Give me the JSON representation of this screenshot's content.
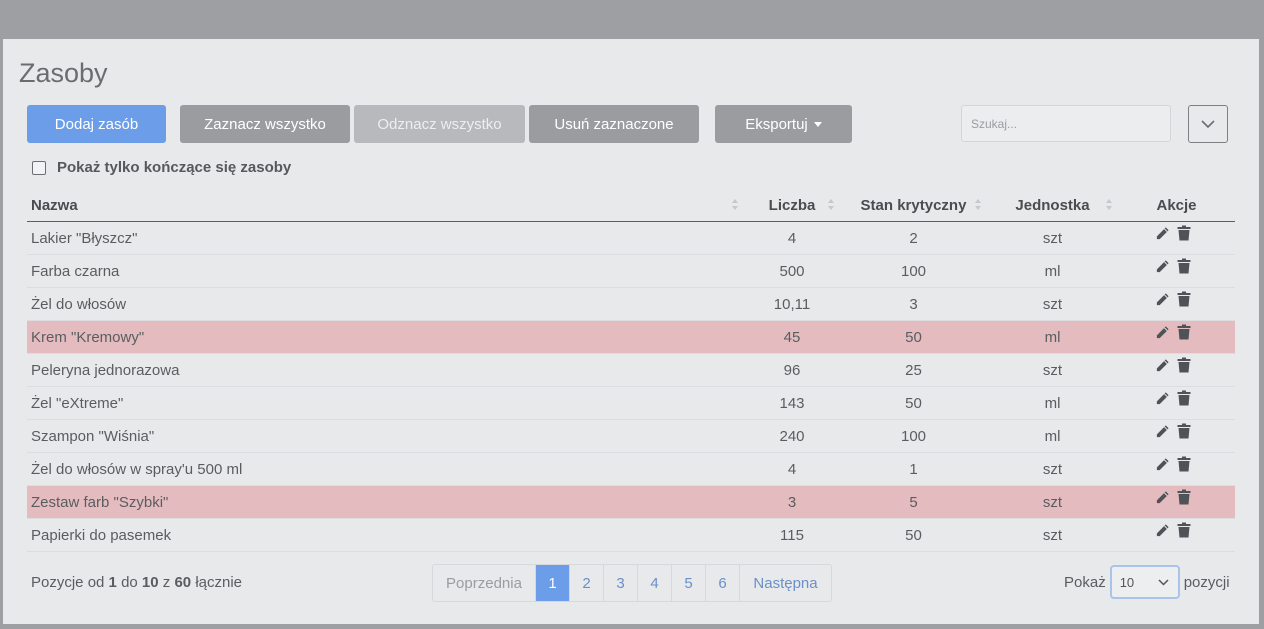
{
  "page": {
    "title": "Zasoby"
  },
  "toolbar": {
    "add_label": "Dodaj zasób",
    "select_all_label": "Zaznacz wszystko",
    "deselect_all_label": "Odznacz wszystko",
    "delete_selected_label": "Usuń zaznaczone",
    "export_label": "Eksportuj",
    "search_placeholder": "Szukaj..."
  },
  "filter": {
    "label": "Pokaż tylko kończące się zasoby",
    "checked": false
  },
  "table": {
    "columns": [
      "Nazwa",
      "Liczba",
      "Stan krytyczny",
      "Jednostka",
      "Akcje"
    ],
    "rows": [
      {
        "name": "Lakier \"Błyszcz\"",
        "count": "4",
        "critical": "2",
        "unit": "szt",
        "warn": false
      },
      {
        "name": "Farba czarna",
        "count": "500",
        "critical": "100",
        "unit": "ml",
        "warn": false
      },
      {
        "name": "Żel do włosów",
        "count": "10,11",
        "critical": "3",
        "unit": "szt",
        "warn": false
      },
      {
        "name": "Krem \"Kremowy\"",
        "count": "45",
        "critical": "50",
        "unit": "ml",
        "warn": true
      },
      {
        "name": "Peleryna jednorazowa",
        "count": "96",
        "critical": "25",
        "unit": "szt",
        "warn": false
      },
      {
        "name": "Żel \"eXtreme\"",
        "count": "143",
        "critical": "50",
        "unit": "ml",
        "warn": false
      },
      {
        "name": "Szampon \"Wiśnia\"",
        "count": "240",
        "critical": "100",
        "unit": "ml",
        "warn": false
      },
      {
        "name": "Żel do włosów w spray'u 500 ml",
        "count": "4",
        "critical": "1",
        "unit": "szt",
        "warn": false
      },
      {
        "name": "Zestaw farb \"Szybki\"",
        "count": "3",
        "critical": "5",
        "unit": "szt",
        "warn": true
      },
      {
        "name": "Papierki do pasemek",
        "count": "115",
        "critical": "50",
        "unit": "szt",
        "warn": false
      }
    ]
  },
  "footer": {
    "info_prefix": "Pozycje od",
    "info_from": "1",
    "info_to_word": "do",
    "info_to": "10",
    "info_of_word": "z",
    "info_total": "60",
    "info_suffix": "łącznie",
    "prev_label": "Poprzednia",
    "next_label": "Następna",
    "pages": [
      "1",
      "2",
      "3",
      "4",
      "5",
      "6"
    ],
    "active_page": "1",
    "show_label": "Pokaż",
    "page_size": "10",
    "positions_label": "pozycji"
  },
  "colors": {
    "primary": "#6c9de8",
    "secondary": "#9a9c9f",
    "warning_row": "#e4bcbf"
  },
  "icons": [
    "chevron-down-icon",
    "pencil-icon",
    "trash-icon",
    "sort-icon",
    "caret-down-icon"
  ]
}
